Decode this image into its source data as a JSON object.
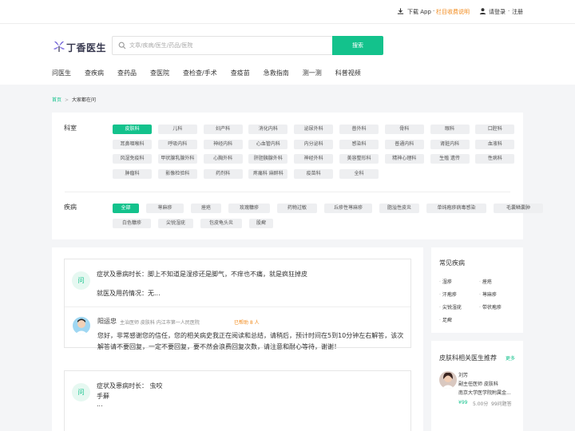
{
  "topbar": {
    "download": "下载 App",
    "dot": "·",
    "charge": "栏目收费说明",
    "login": "请登录",
    "dot2": "·",
    "register": "注册"
  },
  "header": {
    "logo_text": "丁香医生",
    "search_placeholder": "文章/疾病/医生/药品/医院",
    "search_button": "搜索"
  },
  "nav": [
    "问医生",
    "查疾病",
    "查药品",
    "查医院",
    "查检查/手术",
    "查疫苗",
    "急救指南",
    "测一测",
    "科普视频"
  ],
  "breadcrumb": {
    "home": "首页",
    "sep": ">",
    "current": "大家都在问"
  },
  "filters": {
    "dept_label": "科室",
    "depts": [
      [
        "皮肤科",
        "儿科",
        "妇产科",
        "消化内科",
        "泌尿外科",
        "普外科",
        "骨科",
        "眼科",
        "口腔科"
      ],
      [
        "耳鼻咽喉科",
        "呼吸内科",
        "神经内科",
        "心血管内科",
        "内分泌科",
        "感染科",
        "普通内科",
        "肾脏内科",
        "血液科"
      ],
      [
        "风湿免疫科",
        "甲状腺乳腺外科",
        "心胸外科",
        "肝胆胰腺外科",
        "神经外科",
        "美容整形科",
        "精神心理科",
        "生殖 遗传",
        "性病科"
      ],
      [
        "肿瘤科",
        "影像检验科",
        "药剂科",
        "疼痛科 麻醉科",
        "疫苗科",
        "全科"
      ]
    ],
    "disease_label": "疾病",
    "diseases": [
      [
        "全部",
        "荨麻疹",
        "痤疮",
        "玫瑰糠疹",
        "药物过敏",
        "丘疹性荨麻疹",
        "脂溢性皮炎",
        "单纯疱疹病毒感染",
        "毛囊鳞囊肿"
      ],
      [
        "白色糠疹",
        "尖锐湿疣",
        "包皮龟头炎",
        "股癣"
      ]
    ]
  },
  "questions": [
    {
      "badge": "问",
      "line1": "症状及患病时长：脚上不知道是湿疹还是脚气，不痒也不痛，就是疯狂掉皮",
      "line2": "就医及用药情况：无...",
      "doctor": "阳运忠",
      "meta": "主治医师  皮肤科  内江市第一人民医院",
      "status": "已帮助 8 人",
      "answer": "您好，非常感谢您的信任，您的相关病史我正在阅读和总结，请稍后，预计时间在5到10分钟左右解答，该次解答请不要回复，一定不要回复，要不然会浪费回复次数，请注意和耐心等待，谢谢！"
    },
    {
      "badge": "问",
      "line1": "症状及患病时长： 虫咬",
      "line2": "手蘚",
      "line3": "..."
    }
  ],
  "sidebar": {
    "common_title": "常见疾病",
    "common": [
      "湿疹",
      "痤疮",
      "汗疱疹",
      "荨麻疹",
      "尖锐湿疣",
      "带状疱疹",
      "足癣"
    ],
    "rec_title": "皮肤科相关医生推荐",
    "more": "更多",
    "doctor_name": "刘芳",
    "doctor_title": "副主任医师  皮肤科",
    "doctor_hospital": "南京大学医学院附属金...",
    "doctor_price": "¥99",
    "doctor_score": "5.00分",
    "doctor_count": "99问题答"
  },
  "colors": {
    "accent": "#13c28c",
    "orange": "#f28a1b"
  }
}
